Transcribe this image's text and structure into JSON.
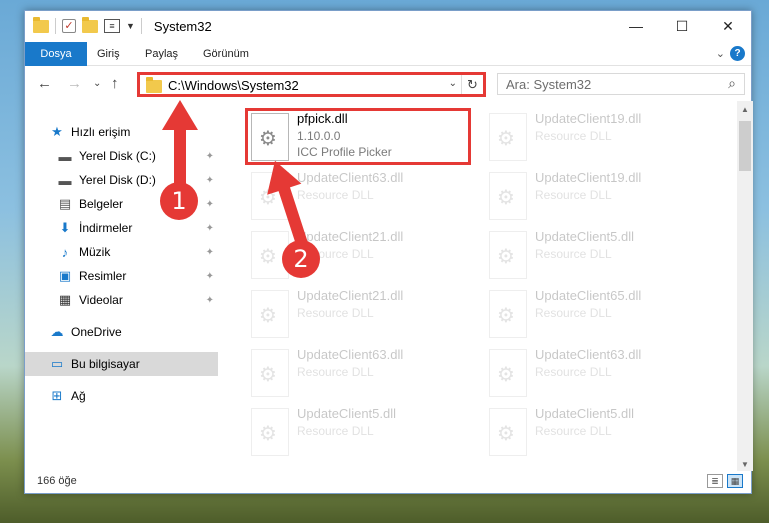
{
  "window": {
    "title": "System32",
    "minimize": "—",
    "maximize": "☐",
    "close": "✕"
  },
  "ribbon": {
    "tabs": [
      "Dosya",
      "Giriş",
      "Paylaş",
      "Görünüm"
    ],
    "expand": "⌄",
    "help": "?"
  },
  "nav": {
    "back": "←",
    "forward": "→",
    "recent": "⌄",
    "up": "↑",
    "address": "C:\\Windows\\System32",
    "address_dropdown": "⌄",
    "refresh": "↻",
    "search_placeholder": "Ara: System32",
    "search_icon": "⌕"
  },
  "sidebar": {
    "items": [
      {
        "label": "Hızlı erişim",
        "icon": "star-icon",
        "glyph": "★"
      },
      {
        "label": "Yerel Disk (C:)",
        "icon": "drive-icon",
        "glyph": "▬",
        "pinned": true
      },
      {
        "label": "Yerel Disk (D:)",
        "icon": "drive-icon",
        "glyph": "▬",
        "pinned": true
      },
      {
        "label": "Belgeler",
        "icon": "documents-icon",
        "glyph": "▤",
        "pinned": true
      },
      {
        "label": "İndirmeler",
        "icon": "download-icon",
        "glyph": "⬇",
        "pinned": true
      },
      {
        "label": "Müzik",
        "icon": "music-icon",
        "glyph": "♪",
        "pinned": true
      },
      {
        "label": "Resimler",
        "icon": "pictures-icon",
        "glyph": "▣",
        "pinned": true
      },
      {
        "label": "Videolar",
        "icon": "video-icon",
        "glyph": "▦",
        "pinned": true
      },
      {
        "label": "OneDrive",
        "icon": "cloud-icon",
        "glyph": "☁"
      },
      {
        "label": "Bu bilgisayar",
        "icon": "computer-icon",
        "glyph": "▭",
        "selected": true
      },
      {
        "label": "Ağ",
        "icon": "network-icon",
        "glyph": "⊞"
      }
    ],
    "pin_glyph": "📌"
  },
  "files": [
    {
      "name": "pfpick.dll",
      "line1": "1.10.0.0",
      "line2": "ICC Profile Picker",
      "highlighted": true
    },
    {
      "name": "UpdateClient19.dll",
      "line1": "Resource DLL"
    },
    {
      "name": "UpdateClient63.dll",
      "line1": "Resource DLL"
    },
    {
      "name": "UpdateClient19.dll",
      "line1": "Resource DLL"
    },
    {
      "name": "UpdateClient21.dll",
      "line1": "Resource DLL"
    },
    {
      "name": "UpdateClient5.dll",
      "line1": "Resource DLL"
    },
    {
      "name": "UpdateClient21.dll",
      "line1": "Resource DLL"
    },
    {
      "name": "UpdateClient65.dll",
      "line1": "Resource DLL"
    },
    {
      "name": "UpdateClient63.dll",
      "line1": "Resource DLL"
    },
    {
      "name": "UpdateClient63.dll",
      "line1": "Resource DLL"
    },
    {
      "name": "UpdateClient5.dll",
      "line1": "Resource DLL"
    },
    {
      "name": "UpdateClient5.dll",
      "line1": "Resource DLL"
    }
  ],
  "status": {
    "item_count": "166 öğe"
  },
  "annotations": {
    "step1": "1",
    "step2": "2",
    "color": "#e53935"
  },
  "colors": {
    "accent": "#1979ca",
    "highlight": "#e53935"
  }
}
